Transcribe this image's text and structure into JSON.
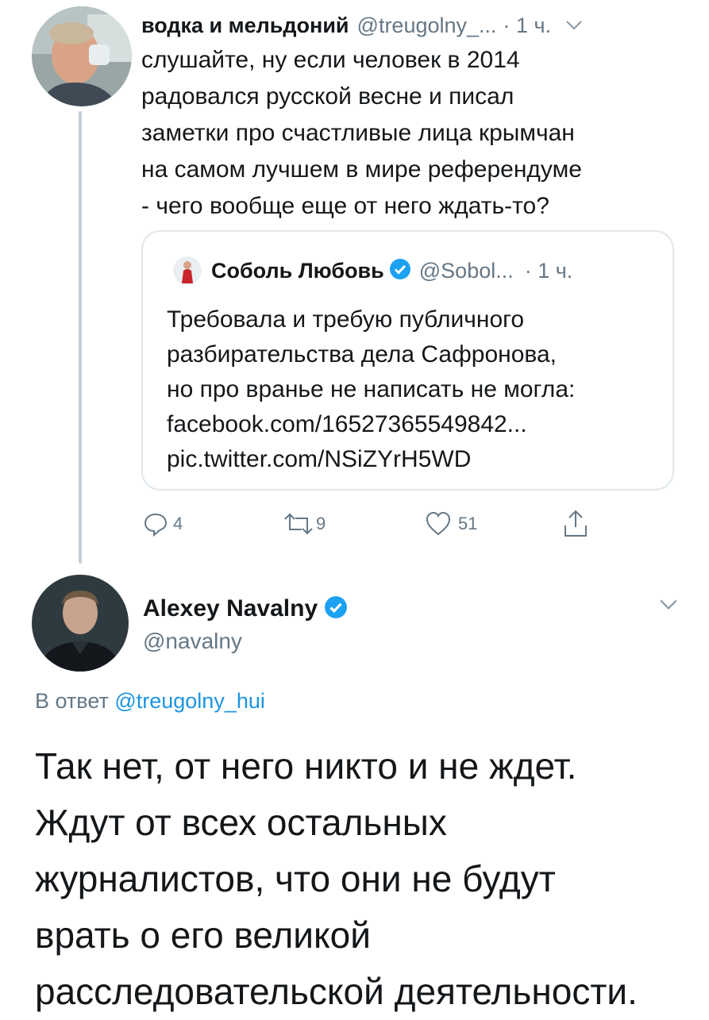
{
  "thread": {
    "parent": {
      "author_name": "водка и мельдоний",
      "author_handle": "@treugolny_...",
      "time": "· 1 ч.",
      "body_lines": [
        "слушайте, ну если человек в 2014",
        "радовался русской весне и писал",
        "заметки про счастливые лица крымчан",
        "на самом лучшем в мире референдуме",
        "- чего вообще еще от него ждать-то?"
      ],
      "quote": {
        "author_name": "Соболь Любовь",
        "author_handle": "@Sobol...",
        "time": "· 1 ч.",
        "body_lines": [
          "Требовала и требую публичного",
          "разбирательства дела Сафронова,",
          "но про вранье не написать не могла:",
          "facebook.com/16527365549842...",
          "pic.twitter.com/NSiZYrH5WD"
        ]
      },
      "actions": {
        "reply_icon": "comment-bubble-icon",
        "replies": "4",
        "retweet_icon": "retweet-arrows-icon",
        "retweets": "9",
        "like_icon": "heart-outline-icon",
        "likes": "51",
        "share_icon": "share-upload-icon"
      }
    },
    "main": {
      "author_name": "Alexey Navalny",
      "author_handle": "@navalny",
      "reply_prefix": "В ответ",
      "reply_handle": "@treugolny_hui",
      "body_lines": [
        "Так нет, от него никто и не ждет.",
        "Ждут от всех остальных",
        "журналистов, что они не будут",
        "врать о его великой",
        "расследовательской деятельности."
      ]
    }
  },
  "colors": {
    "text": "#14171a",
    "secondary": "#657786",
    "link": "#1b95e0",
    "verified": "#1da1f2",
    "border": "#e1e8ed"
  }
}
